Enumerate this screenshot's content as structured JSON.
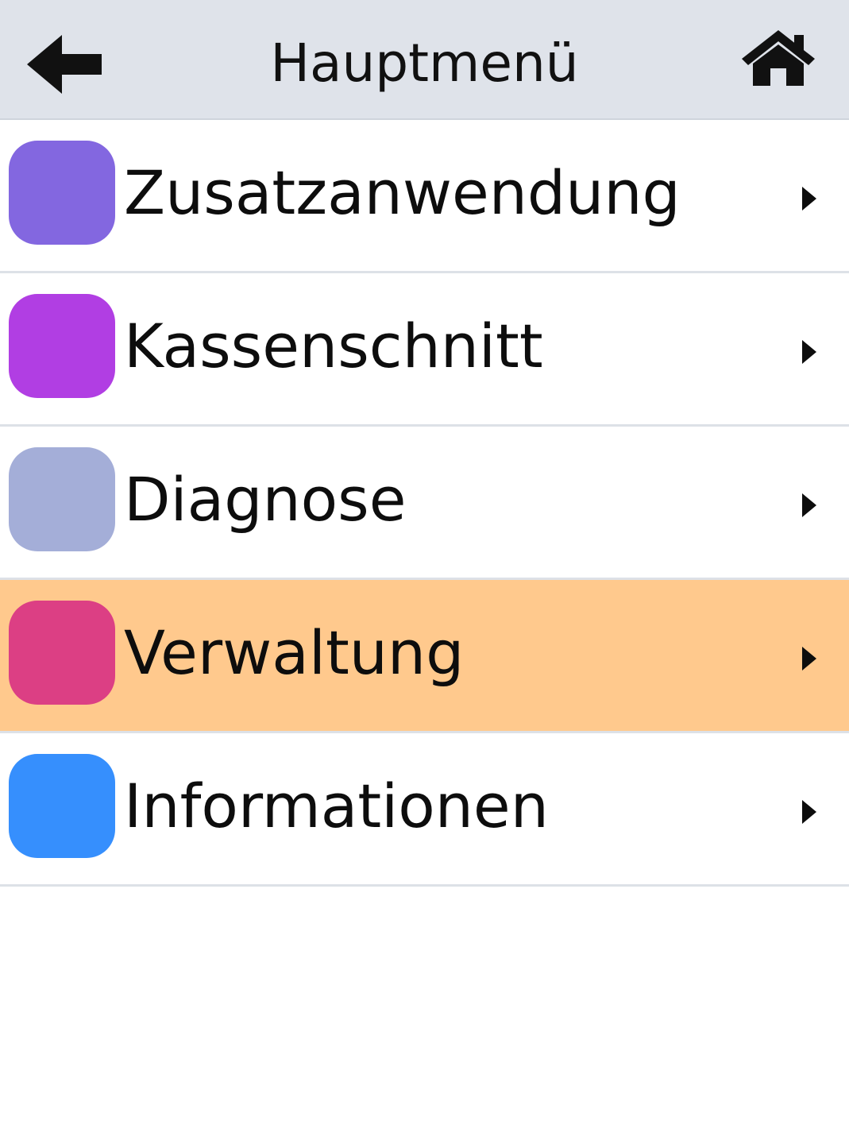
{
  "header": {
    "title": "Hauptmenü",
    "back_icon": "arrow-left-icon",
    "home_icon": "home-icon"
  },
  "menu": {
    "selected_index": 3,
    "selected_color": "#ffc98d",
    "items": [
      {
        "label": "Zusatzanwendung",
        "color": "#8367e0"
      },
      {
        "label": "Kassenschnitt",
        "color": "#b13ee3"
      },
      {
        "label": "Diagnose",
        "color": "#a4aed8"
      },
      {
        "label": "Verwaltung",
        "color": "#dc3f84"
      },
      {
        "label": "Informationen",
        "color": "#368ffd"
      }
    ],
    "chevron_icon": "chevron-right-icon"
  }
}
